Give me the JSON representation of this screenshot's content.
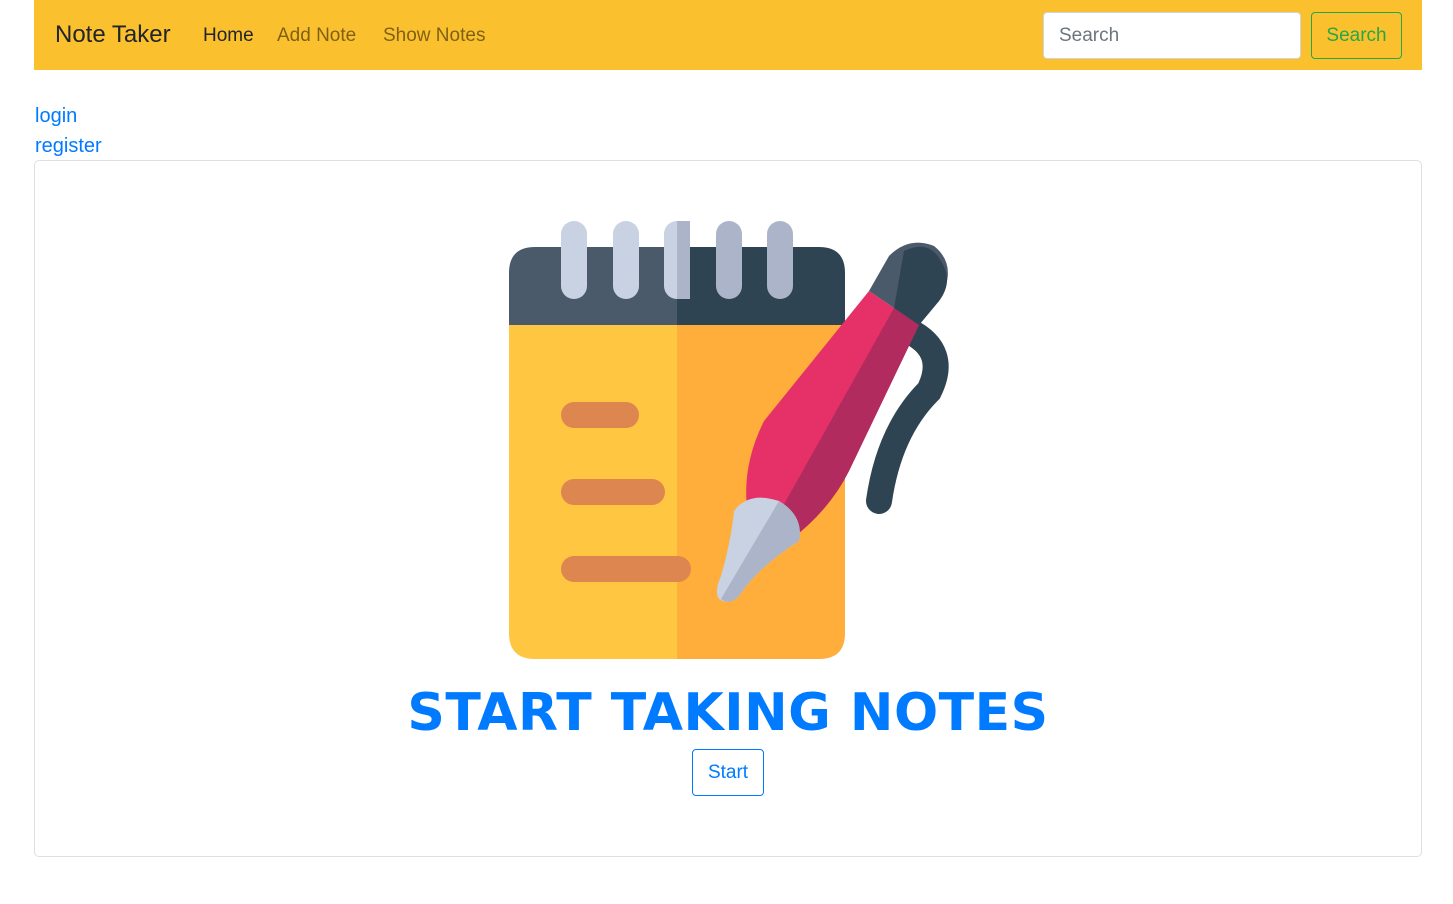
{
  "navbar": {
    "brand": "Note Taker",
    "links": [
      {
        "label": "Home",
        "active": true
      },
      {
        "label": "Add Note",
        "active": false
      },
      {
        "label": "Show Notes",
        "active": false
      }
    ],
    "search": {
      "placeholder": "Search",
      "value": ""
    },
    "search_button": "Search",
    "background_color": "#fbc02d"
  },
  "auth": {
    "login": "login",
    "register": "register"
  },
  "hero": {
    "icon": "notepad-pen-icon",
    "title": "START TAKING NOTES",
    "start_button": "Start"
  },
  "colors": {
    "primary": "#007bff",
    "success": "#28a745"
  }
}
